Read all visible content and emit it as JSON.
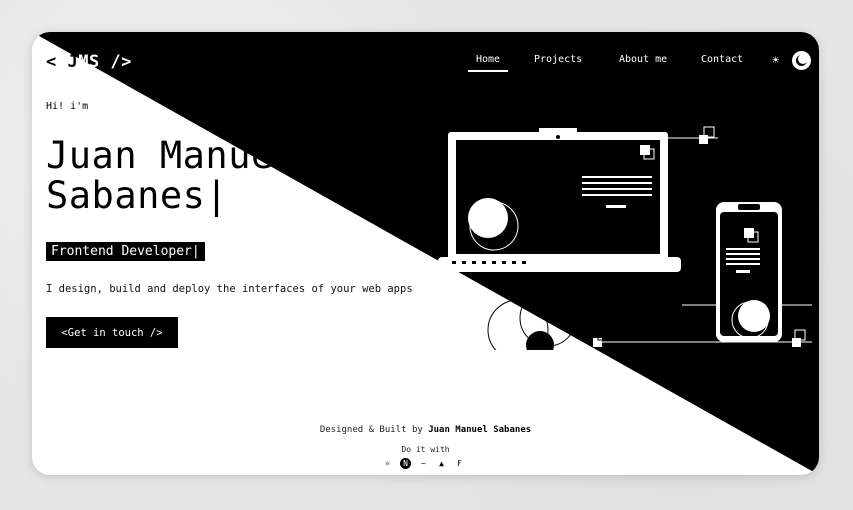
{
  "logo": {
    "open": "< J",
    "close": "MS />"
  },
  "nav": {
    "items": [
      {
        "label": "Home",
        "active": true
      },
      {
        "label": "Projects",
        "active": false
      },
      {
        "label": "About me",
        "active": false
      },
      {
        "label": "Contact",
        "active": false
      }
    ]
  },
  "theme": {
    "sun_icon": "☀"
  },
  "hero": {
    "greeting": "Hi! i'm",
    "name_line1": "Juan Manuel",
    "name_line2": "Sabanes|",
    "role": "Frontend Developer|",
    "description": "I design, build and deploy the interfaces of your web apps",
    "cta": "<Get in touch />"
  },
  "footer": {
    "designed_prefix": "Designed & Built by ",
    "author": "Juan Manuel Sabanes",
    "do_it_with": "Do it with",
    "tech_icons": [
      "react-icon",
      "nextjs-icon",
      "tailwind-icon",
      "vercel-icon",
      "framer-icon"
    ]
  }
}
